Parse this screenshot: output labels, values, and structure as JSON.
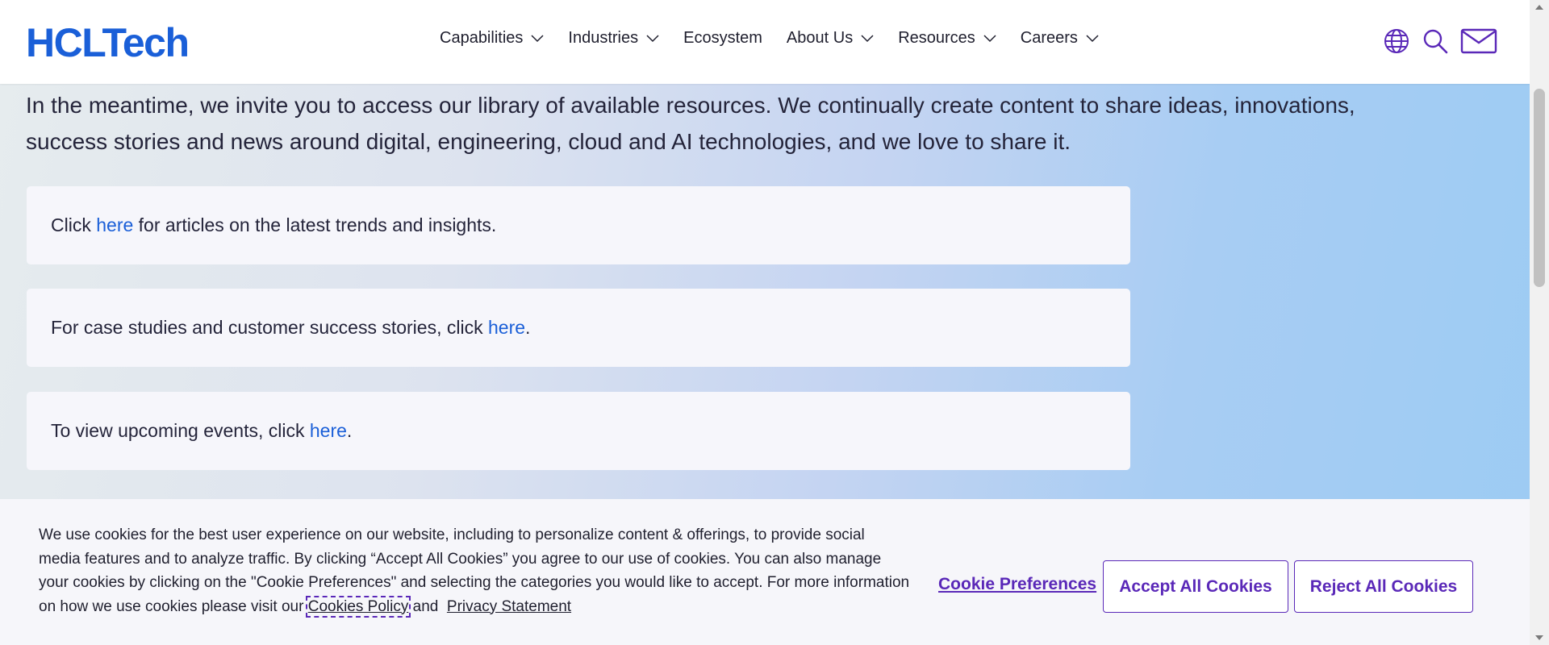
{
  "header": {
    "logo": "HCLTech",
    "nav": [
      {
        "label": "Capabilities",
        "has_dropdown": true
      },
      {
        "label": "Industries",
        "has_dropdown": true
      },
      {
        "label": "Ecosystem",
        "has_dropdown": false
      },
      {
        "label": "About Us",
        "has_dropdown": true
      },
      {
        "label": "Resources",
        "has_dropdown": true
      },
      {
        "label": "Careers",
        "has_dropdown": true
      }
    ],
    "icons": [
      "globe-icon",
      "search-icon",
      "mail-icon"
    ]
  },
  "main": {
    "intro": "In the meantime, we invite you to access our library of available resources. We continually create content to share ideas, innovations, success stories and news around digital, engineering, cloud and AI technologies, and we love to share it.",
    "cards": [
      {
        "before": "Click ",
        "link": "here",
        "after": " for articles on the latest trends and insights."
      },
      {
        "before": "For case studies and customer success stories, click ",
        "link": "here",
        "after": "."
      },
      {
        "before": "To view upcoming events, click ",
        "link": "here",
        "after": "."
      }
    ]
  },
  "cookie_banner": {
    "text": "We use cookies for the best user experience on our website, including to personalize content & offerings, to provide social media features and to analyze traffic. By clicking “Accept All Cookies” you agree to our use of cookies. You can also manage your cookies by clicking on the \"Cookie Preferences\" and selecting the categories you would like to accept. For more information on how we use cookies please visit our",
    "cookies_policy_link": "Cookies Policy",
    "and": "and",
    "privacy_link": "Privacy Statement",
    "preferences_label": "Cookie Preferences",
    "accept_label": "Accept All Cookies",
    "reject_label": "Reject All Cookies"
  },
  "colors": {
    "brand_blue": "#1a5fd8",
    "accent_purple": "#5a28b8"
  }
}
